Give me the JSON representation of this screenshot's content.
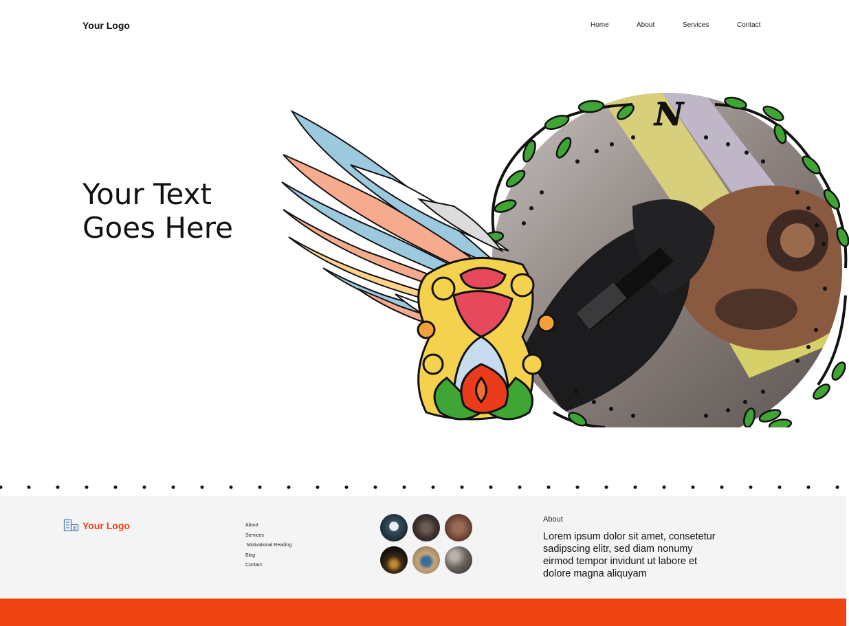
{
  "header": {
    "logo_text": "Your Logo",
    "nav": [
      {
        "label": "Home"
      },
      {
        "label": "About"
      },
      {
        "label": "Services"
      },
      {
        "label": "Contact"
      }
    ]
  },
  "hero": {
    "title_line1": "Your Text",
    "title_line2": "Goes Here",
    "emblem_letter": "N",
    "image_icon": "tattoo-artwork-image"
  },
  "footer": {
    "logo_text": "Your Logo",
    "logo_icon": "building-icon",
    "links": [
      {
        "label": "About"
      },
      {
        "label": "Services"
      },
      {
        "label": "Motivational Reading"
      },
      {
        "label": "Blog"
      },
      {
        "label": "Contact"
      }
    ],
    "about_title": "About",
    "about_text": "Lorem ipsum dolor sit amet, consetetur sadipscing elitr, sed diam nonumy eirmod tempor invidunt ut labore et dolore magna aliquyam"
  },
  "colors": {
    "accent": "#f04314",
    "footer_bg": "#f4f4f4",
    "leaf_green": "#3fa535"
  }
}
